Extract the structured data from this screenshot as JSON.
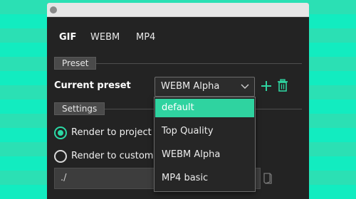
{
  "tabs": [
    {
      "label": "GIF",
      "active": true
    },
    {
      "label": "WEBM",
      "active": false
    },
    {
      "label": "MP4",
      "active": false
    }
  ],
  "preset_section": {
    "label": "Preset"
  },
  "current_preset": {
    "label": "Current preset",
    "selected": "WEBM Alpha",
    "add_icon": "plus-icon",
    "delete_icon": "trash-icon"
  },
  "settings_section": {
    "label": "Settings"
  },
  "render": {
    "project_folder_label": "Render to project fol",
    "project_folder_checked": true,
    "custom_folder_label": "Render to custom fo",
    "custom_folder_checked": false,
    "path_value": "./",
    "folder_icon": "folder-icon"
  },
  "dropdown": {
    "options": [
      {
        "label": "default",
        "highlighted": true
      },
      {
        "label": "Top Quality",
        "highlighted": false
      },
      {
        "label": "WEBM Alpha",
        "highlighted": false
      },
      {
        "label": "MP4 basic",
        "highlighted": false
      }
    ]
  },
  "colors": {
    "accent": "#2fd3a0",
    "window_bg": "#232323",
    "background_stripe_a": "#2be0b4",
    "background_stripe_b": "#12ecc0"
  }
}
